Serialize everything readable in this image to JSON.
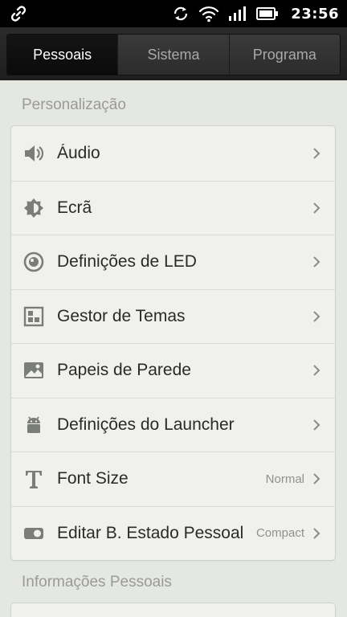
{
  "status_bar": {
    "time": "23:56",
    "icons": [
      "link-icon",
      "sync-icon",
      "wifi-icon",
      "signal-icon",
      "battery-icon"
    ]
  },
  "tabs": [
    {
      "label": "Pessoais",
      "active": true
    },
    {
      "label": "Sistema",
      "active": false
    },
    {
      "label": "Programa",
      "active": false
    }
  ],
  "sections": {
    "personalizacao": {
      "title": "Personalização",
      "items": [
        {
          "label": "Áudio",
          "icon": "speaker-icon",
          "value": ""
        },
        {
          "label": "Ecrã",
          "icon": "brightness-icon",
          "value": ""
        },
        {
          "label": "Definições de LED",
          "icon": "led-icon",
          "value": ""
        },
        {
          "label": "Gestor de Temas",
          "icon": "themes-icon",
          "value": ""
        },
        {
          "label": "Papeis de Parede",
          "icon": "wallpaper-icon",
          "value": ""
        },
        {
          "label": "Definições do Launcher",
          "icon": "android-icon",
          "value": ""
        },
        {
          "label": "Font Size",
          "icon": "font-icon",
          "value": "Normal"
        },
        {
          "label": "Editar B. Estado Pessoal",
          "icon": "toggle-icon",
          "value": "Compact"
        }
      ]
    },
    "informacoes": {
      "title": "Informações Pessoais"
    }
  },
  "colors": {
    "background": "#e5e7e2",
    "card": "#f0f1ed",
    "icon_gray": "#7b7d79",
    "tab_active_text": "#ffffff",
    "tab_inactive_text": "#a9a9a9"
  }
}
